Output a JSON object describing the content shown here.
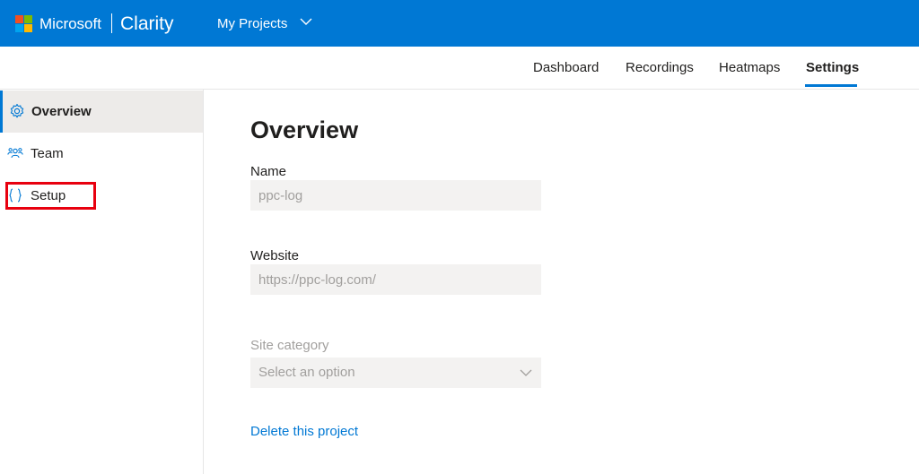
{
  "header": {
    "brand_company": "Microsoft",
    "brand_product": "Clarity",
    "project_switcher": "My Projects"
  },
  "nav": {
    "tabs": [
      {
        "label": "Dashboard"
      },
      {
        "label": "Recordings"
      },
      {
        "label": "Heatmaps"
      },
      {
        "label": "Settings",
        "active": true
      }
    ]
  },
  "sidebar": {
    "items": [
      {
        "label": "Overview",
        "icon": "gear-icon",
        "active": true
      },
      {
        "label": "Team",
        "icon": "team-icon"
      },
      {
        "label": "Setup",
        "icon": "braces-icon",
        "highlighted": true
      }
    ]
  },
  "main": {
    "title": "Overview",
    "name_label": "Name",
    "name_value": "ppc-log",
    "website_label": "Website",
    "website_value": "https://ppc-log.com/",
    "category_label": "Site category",
    "category_placeholder": "Select an option",
    "delete_link": "Delete this project"
  },
  "colors": {
    "brand_blue": "#0078d4",
    "highlight_red": "#e8000f",
    "input_bg": "#f3f2f1"
  }
}
